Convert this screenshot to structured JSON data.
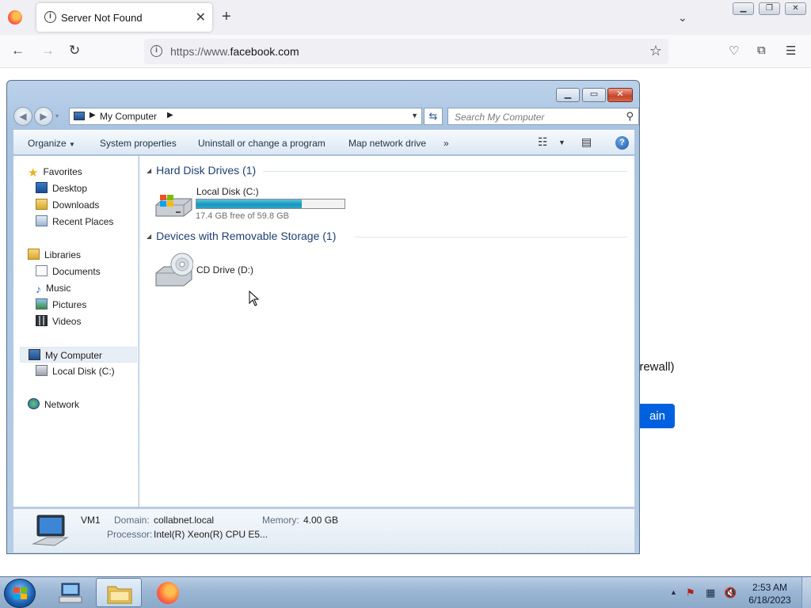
{
  "browser": {
    "tab_title": "Server Not Found",
    "url_prefix": "https://www.",
    "url_domain": "facebook.com",
    "new_tab_label": "+",
    "page_text_fragment": "irewall)",
    "page_button_fragment": "ain"
  },
  "explorer": {
    "address_crumb": "My Computer",
    "search_placeholder": "Search My Computer",
    "commands": {
      "organize": "Organize",
      "system_properties": "System properties",
      "uninstall": "Uninstall or change a program",
      "map_drive": "Map network drive",
      "more": "»"
    },
    "nav": {
      "favorites": "Favorites",
      "desktop": "Desktop",
      "downloads": "Downloads",
      "recent_places": "Recent Places",
      "libraries": "Libraries",
      "documents": "Documents",
      "music": "Music",
      "pictures": "Pictures",
      "videos": "Videos",
      "my_computer": "My Computer",
      "local_disk": "Local Disk (C:)",
      "network": "Network"
    },
    "groups": {
      "hard_disks": "Hard Disk Drives (1)",
      "removable": "Devices with Removable Storage (1)"
    },
    "drives": {
      "c_label": "Local Disk (C:)",
      "c_free": "17.4 GB free of 59.8 GB",
      "c_used_fraction": 0.709,
      "d_label": "CD Drive (D:)"
    },
    "details": {
      "name": "VM1",
      "domain_label": "Domain:",
      "domain_value": "collabnet.local",
      "memory_label": "Memory:",
      "memory_value": "4.00 GB",
      "processor_label": "Processor:",
      "processor_value": "Intel(R) Xeon(R) CPU E5..."
    }
  },
  "taskbar": {
    "time": "2:53 AM",
    "date": "6/18/2023"
  },
  "colors": {
    "capacity_bar": "#1b95bd",
    "page_button": "#0061e0",
    "group_heading": "#1e3f73"
  }
}
